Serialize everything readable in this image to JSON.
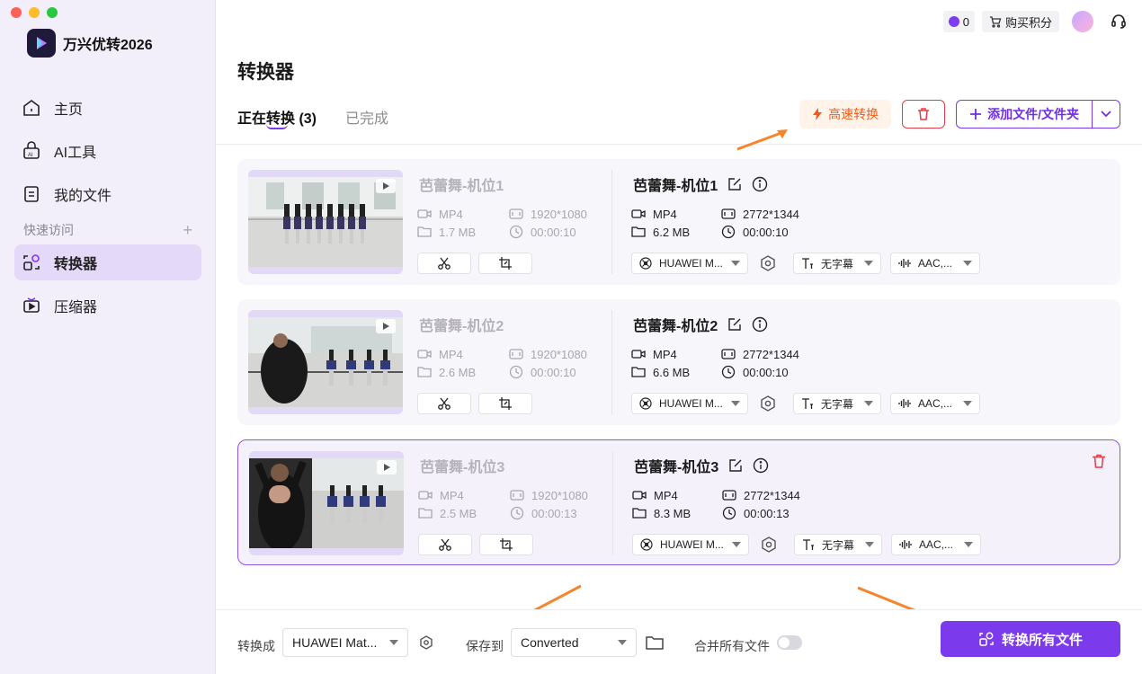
{
  "app": {
    "name": "万兴优转2026"
  },
  "sidebar": {
    "items": [
      {
        "label": "主页"
      },
      {
        "label": "AI工具"
      },
      {
        "label": "我的文件"
      }
    ],
    "quick_access_label": "快速访问",
    "quick_items": [
      {
        "label": "转换器"
      },
      {
        "label": "压缩器"
      }
    ]
  },
  "topbar": {
    "credits": "0",
    "buy_label": "购买积分"
  },
  "page": {
    "title": "转换器"
  },
  "tabs": {
    "converting": "正在转换 (3)",
    "done": "已完成"
  },
  "toolbar": {
    "fast_label": "高速转换",
    "add_label": "添加文件/文件夹"
  },
  "files": [
    {
      "src_name": "芭蕾舞-机位1",
      "src_format": "MP4",
      "src_resolution": "1920*1080",
      "src_size": "1.7 MB",
      "src_duration": "00:00:10",
      "dst_name": "芭蕾舞-机位1",
      "dst_format": "MP4",
      "dst_resolution": "2772*1344",
      "dst_size": "6.2 MB",
      "dst_duration": "00:00:10",
      "device": "HUAWEI M...",
      "subtitle": "无字幕",
      "audio": "AAC,..."
    },
    {
      "src_name": "芭蕾舞-机位2",
      "src_format": "MP4",
      "src_resolution": "1920*1080",
      "src_size": "2.6 MB",
      "src_duration": "00:00:10",
      "dst_name": "芭蕾舞-机位2",
      "dst_format": "MP4",
      "dst_resolution": "2772*1344",
      "dst_size": "6.6 MB",
      "dst_duration": "00:00:10",
      "device": "HUAWEI M...",
      "subtitle": "无字幕",
      "audio": "AAC,..."
    },
    {
      "src_name": "芭蕾舞-机位3",
      "src_format": "MP4",
      "src_resolution": "1920*1080",
      "src_size": "2.5 MB",
      "src_duration": "00:00:13",
      "dst_name": "芭蕾舞-机位3",
      "dst_format": "MP4",
      "dst_resolution": "2772*1344",
      "dst_size": "8.3 MB",
      "dst_duration": "00:00:13",
      "device": "HUAWEI M...",
      "subtitle": "无字幕",
      "audio": "AAC,..."
    }
  ],
  "bottom": {
    "convert_to_label": "转换成",
    "convert_to_value": "HUAWEI Mat...",
    "save_to_label": "保存到",
    "save_to_value": "Converted",
    "merge_label": "合并所有文件",
    "convert_all_label": "转换所有文件"
  },
  "colors": {
    "accent": "#7c3aed",
    "fast": "#f25c19",
    "danger": "#e23c48",
    "annotation_arrow": "#f5842a"
  }
}
